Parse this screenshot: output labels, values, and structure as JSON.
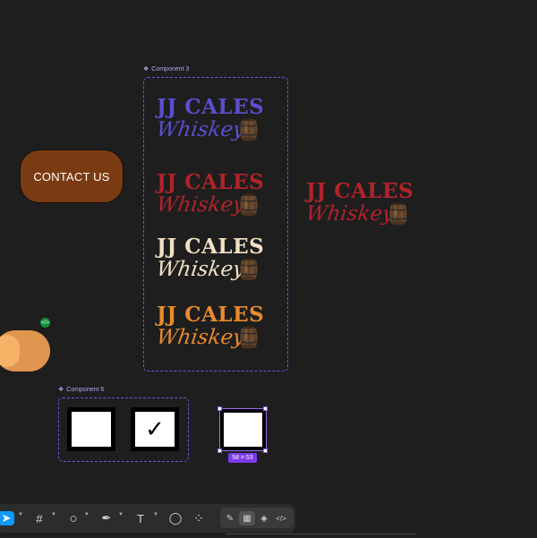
{
  "canvas": {
    "background": "#1e1e1e"
  },
  "components": {
    "component3": {
      "label": "Component 3",
      "icon": "component-diamond-icon"
    },
    "component6": {
      "label": "Component 6",
      "icon": "component-diamond-icon"
    }
  },
  "contact_button": {
    "label": "CONTACT US",
    "color": "#7b3b12"
  },
  "brand": {
    "line1": "JJ CALES",
    "line2": "Whiskey",
    "icon": "whiskey-barrel-icon",
    "variants": [
      {
        "name": "blue",
        "color": "#5b4fcf"
      },
      {
        "name": "red",
        "color": "#b0232a"
      },
      {
        "name": "cream",
        "color": "#f1e0c3"
      },
      {
        "name": "orange",
        "color": "#e88a2c"
      }
    ],
    "standalone_color": "#b0232a"
  },
  "toggle": {
    "color": "#e0954f",
    "state": "off",
    "badge_icon": "code-icon"
  },
  "checkboxes": [
    {
      "checked": false
    },
    {
      "checked": true,
      "mark": "✓"
    }
  ],
  "selection": {
    "size_label": "58 ⌗ 53"
  },
  "toolbar": {
    "tools": [
      {
        "name": "move",
        "icon": "cursor-icon",
        "glyph": "➤",
        "active": true
      },
      {
        "name": "frame",
        "icon": "frame-hash-icon",
        "glyph": "#"
      },
      {
        "name": "shape",
        "icon": "ellipse-icon",
        "glyph": "○"
      },
      {
        "name": "pen",
        "icon": "pen-icon",
        "glyph": "✒"
      },
      {
        "name": "text",
        "icon": "text-icon",
        "glyph": "T"
      },
      {
        "name": "comment",
        "icon": "comment-icon",
        "glyph": "◯"
      },
      {
        "name": "actions",
        "icon": "actions-icon",
        "glyph": "⁘"
      }
    ],
    "modes": [
      {
        "name": "draw",
        "icon": "draw-mode-icon",
        "glyph": "✎"
      },
      {
        "name": "design",
        "icon": "design-mode-icon",
        "glyph": "▦",
        "active": true
      },
      {
        "name": "prototype",
        "icon": "prototype-mode-icon",
        "glyph": "◈"
      },
      {
        "name": "dev",
        "icon": "dev-mode-icon",
        "glyph": "</>"
      }
    ]
  }
}
